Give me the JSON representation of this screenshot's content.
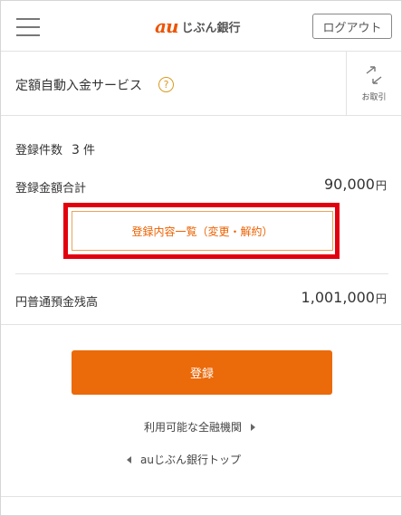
{
  "header": {
    "logo_mark": "au",
    "logo_text": "じぶん銀行",
    "logout_label": "ログアウト"
  },
  "titlebar": {
    "title": "定額自動入金サービス",
    "help_symbol": "?",
    "transfer_label": "お取引"
  },
  "summary": {
    "count_label": "登録件数",
    "count_value": "3",
    "count_unit": "件",
    "total_label": "登録金額合計",
    "total_value": "90,000",
    "currency_unit": "円",
    "list_button_label": "登録内容一覧（変更・解約）",
    "balance_label": "円普通預金残高",
    "balance_value": "1,001,000"
  },
  "actions": {
    "register_label": "登録",
    "institutions_link": "利用可能な全融機関",
    "top_link": "auじぶん銀行トップ"
  },
  "colors": {
    "accent": "#eb6a0a",
    "highlight": "#e2000f",
    "help": "#d99a1e"
  }
}
